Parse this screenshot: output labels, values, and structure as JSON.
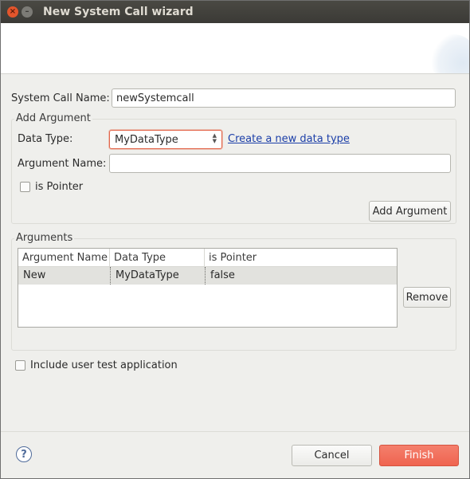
{
  "window": {
    "title": "New System Call wizard",
    "close_glyph": "×",
    "min_glyph": "–"
  },
  "form": {
    "system_call_name_label": "System Call Name:",
    "system_call_name_value": "newSystemcall"
  },
  "add_argument": {
    "group_title": "Add Argument",
    "data_type_label": "Data Type:",
    "data_type_value": "MyDataType",
    "create_link": "Create a new data type",
    "argument_name_label": "Argument Name:",
    "argument_name_value": "",
    "is_pointer_label": "is Pointer",
    "add_button": "Add Argument"
  },
  "arguments": {
    "group_title": "Arguments",
    "columns": [
      "Argument Name",
      "Data Type",
      "is Pointer"
    ],
    "rows": [
      [
        "New",
        "MyDataType",
        "false"
      ]
    ],
    "remove_button": "Remove"
  },
  "include_test_label": "Include user test application",
  "footer": {
    "help_glyph": "?",
    "cancel_button": "Cancel",
    "finish_button": "Finish"
  },
  "colors": {
    "accent": "#ef6450",
    "titlebar": "#3b3a36",
    "link": "#1b3ea8"
  }
}
